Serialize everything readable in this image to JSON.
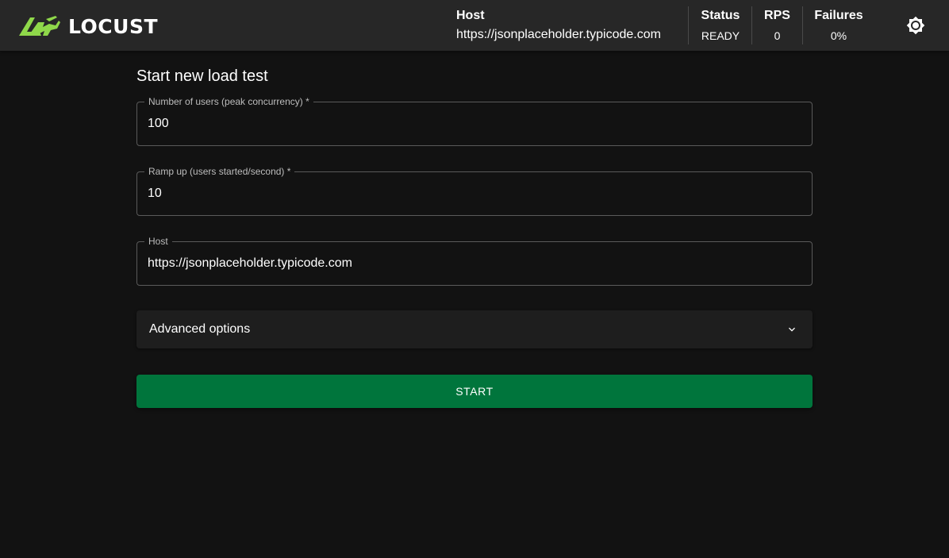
{
  "colors": {
    "background": "#121212",
    "header_background": "#272727",
    "brand_green": "#8fd84a",
    "start_button": "#00753c"
  },
  "header": {
    "logo_text": "LOCUST",
    "logo_icon": "locust-logo-icon",
    "host": {
      "label": "Host",
      "value": "https://jsonplaceholder.typicode.com"
    },
    "status": {
      "label": "Status",
      "value": "READY"
    },
    "rps": {
      "label": "RPS",
      "value": "0"
    },
    "failures": {
      "label": "Failures",
      "value": "0%"
    },
    "theme_toggle_icon": "brightness-icon"
  },
  "form": {
    "title": "Start new load test",
    "users": {
      "label": "Number of users (peak concurrency) *",
      "value": "100"
    },
    "ramp_up": {
      "label": "Ramp up (users started/second) *",
      "value": "10"
    },
    "host": {
      "label": "Host",
      "value": "https://jsonplaceholder.typicode.com"
    },
    "advanced": {
      "label": "Advanced options",
      "icon": "chevron-down-icon"
    },
    "start_label": "START"
  }
}
